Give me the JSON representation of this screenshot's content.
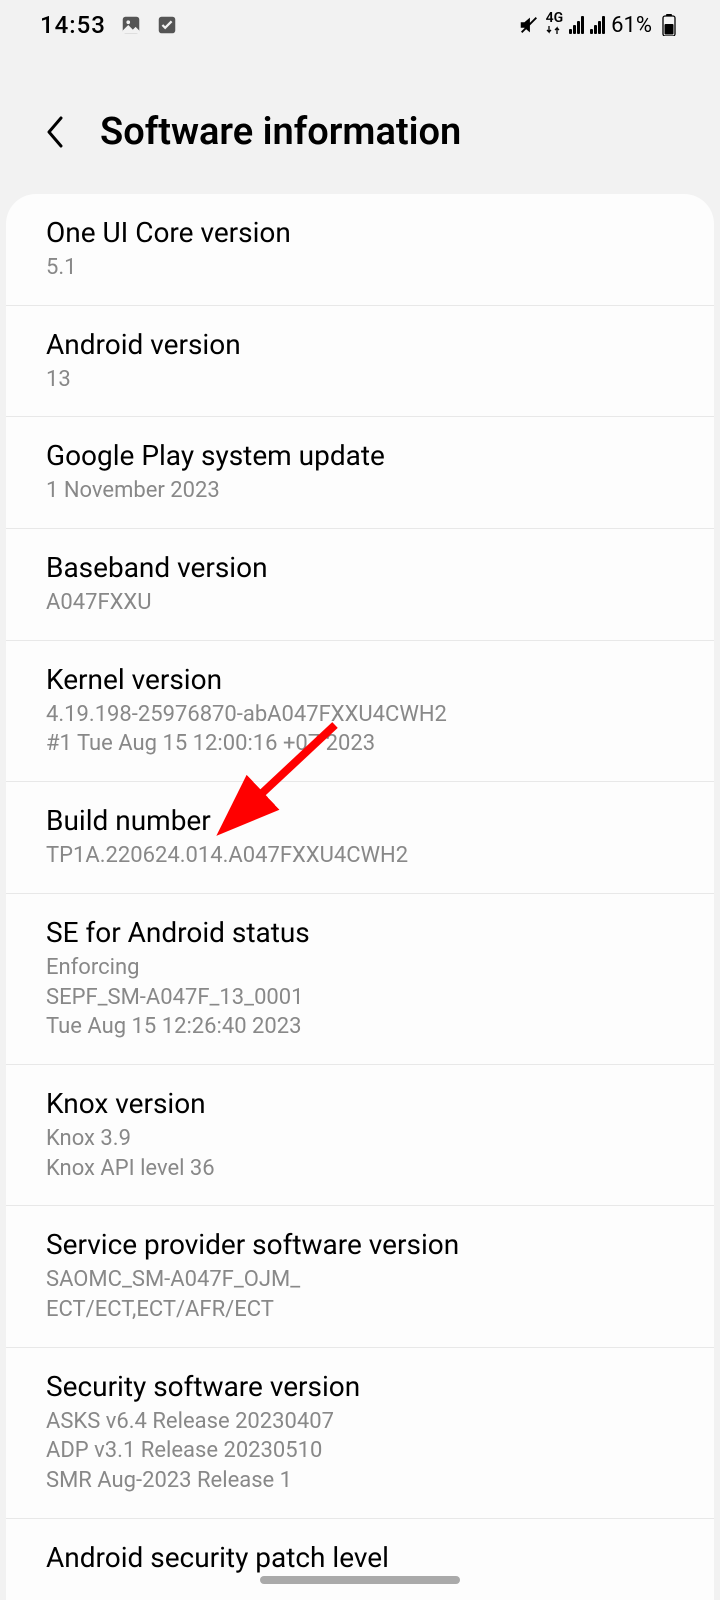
{
  "status_bar": {
    "time": "14:53",
    "battery_text": "61%",
    "network_label": "4G"
  },
  "header": {
    "title": "Software information"
  },
  "items": [
    {
      "title": "One UI Core version",
      "subtitle": "5.1"
    },
    {
      "title": "Android version",
      "subtitle": "13"
    },
    {
      "title": "Google Play system update",
      "subtitle": "1 November 2023"
    },
    {
      "title": "Baseband version",
      "subtitle": "A047FXXU"
    },
    {
      "title": "Kernel version",
      "subtitle": "4.19.198-25976870-abA047FXXU4CWH2\n#1 Tue Aug 15 12:00:16 +07 2023"
    },
    {
      "title": "Build number",
      "subtitle": "TP1A.220624.014.A047FXXU4CWH2"
    },
    {
      "title": "SE for Android status",
      "subtitle": "Enforcing\nSEPF_SM-A047F_13_0001\nTue Aug 15 12:26:40 2023"
    },
    {
      "title": "Knox version",
      "subtitle": "Knox 3.9\nKnox API level 36"
    },
    {
      "title": "Service provider software version",
      "subtitle": "SAOMC_SM-A047F_OJM_\nECT/ECT,ECT/AFR/ECT"
    },
    {
      "title": "Security software version",
      "subtitle": "ASKS v6.4 Release 20230407\nADP v3.1 Release 20230510\nSMR Aug-2023 Release 1"
    },
    {
      "title": "Android security patch level",
      "subtitle": ""
    }
  ],
  "annotation": {
    "arrow_color": "#ff0000"
  }
}
